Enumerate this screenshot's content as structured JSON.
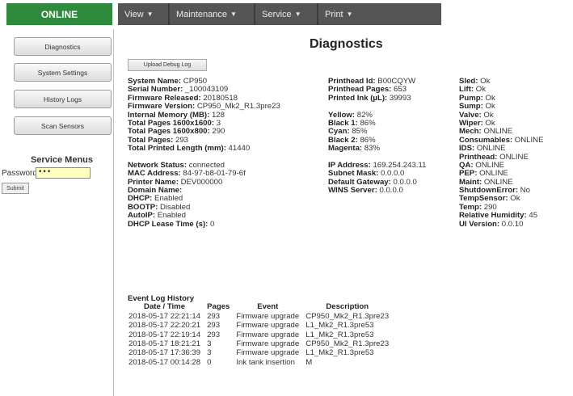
{
  "header": {
    "status": "ONLINE",
    "menu": [
      {
        "label": "View",
        "caret": "▼"
      },
      {
        "label": "Maintenance",
        "caret": "▼"
      },
      {
        "label": "Service",
        "caret": "▼"
      },
      {
        "label": "Print",
        "caret": "▼"
      }
    ]
  },
  "sidebar": {
    "buttons": [
      "Diagnostics",
      "System Settings",
      "History Logs",
      "Scan Sensors"
    ],
    "service_title": "Service Menus",
    "password_label": "Password",
    "password_value": "•••",
    "submit_label": "Submit"
  },
  "main": {
    "title": "Diagnostics",
    "upload_label": "Upload Debug Log",
    "col1_top": [
      {
        "k": "System Name:",
        "v": " CP950"
      },
      {
        "k": "Serial Number:",
        "v": " _100043109"
      },
      {
        "k": "Firmware Released:",
        "v": " 20180518"
      },
      {
        "k": "Firmware Version:",
        "v": " CP950_Mk2_R1.3pre23"
      },
      {
        "k": "Internal Memory (MB):",
        "v": " 128"
      },
      {
        "k": "Total Pages 1600x1600:",
        "v": " 3"
      },
      {
        "k": "Total Pages 1600x800:",
        "v": " 290"
      },
      {
        "k": "Total Pages:",
        "v": " 293"
      },
      {
        "k": "Total Printed Length (mm):",
        "v": " 41440"
      }
    ],
    "col1_bottom": [
      {
        "k": "Network Status:",
        "v": " connected"
      },
      {
        "k": "MAC Address:",
        "v": " 84-97-b8-01-79-6f"
      },
      {
        "k": "Printer Name:",
        "v": " DEV000000"
      },
      {
        "k": "Domain Name:",
        "v": ""
      },
      {
        "k": "DHCP:",
        "v": " Enabled"
      },
      {
        "k": "BOOTP:",
        "v": " Disabled"
      },
      {
        "k": "AutoIP:",
        "v": " Enabled"
      },
      {
        "k": "DHCP Lease Time (s):",
        "v": " 0"
      }
    ],
    "col2_top": [
      {
        "k": "Printhead Id:",
        "v": " B00CQYW"
      },
      {
        "k": "Printhead Pages:",
        "v": " 653"
      },
      {
        "k": "Printed Ink (µL):",
        "v": " 39993"
      }
    ],
    "col2_ink": [
      {
        "k": "Yellow:",
        "v": " 82%"
      },
      {
        "k": "Black 1:",
        "v": " 86%"
      },
      {
        "k": "Cyan:",
        "v": " 85%"
      },
      {
        "k": "Black 2:",
        "v": " 86%"
      },
      {
        "k": "Magenta:",
        "v": " 83%"
      }
    ],
    "col2_net": [
      {
        "k": "IP Address:",
        "v": " 169.254.243.11"
      },
      {
        "k": "Subnet Mask:",
        "v": " 0.0.0.0"
      },
      {
        "k": "Default Gateway:",
        "v": " 0.0.0.0"
      },
      {
        "k": "WINS Server:",
        "v": " 0.0.0.0"
      }
    ],
    "col3": [
      {
        "k": "Sled:",
        "v": " Ok"
      },
      {
        "k": "Lift:",
        "v": " Ok"
      },
      {
        "k": "Pump:",
        "v": " Ok"
      },
      {
        "k": "Sump:",
        "v": " Ok"
      },
      {
        "k": "Valve:",
        "v": " Ok"
      },
      {
        "k": "Wiper:",
        "v": " Ok"
      },
      {
        "k": "Mech:",
        "v": " ONLINE"
      },
      {
        "k": "Consumables:",
        "v": " ONLINE"
      },
      {
        "k": "IDS:",
        "v": " ONLINE"
      },
      {
        "k": "Printhead:",
        "v": " ONLINE"
      },
      {
        "k": "QA:",
        "v": " ONLINE"
      },
      {
        "k": "PEP:",
        "v": " ONLINE"
      },
      {
        "k": "Maint:",
        "v": " ONLINE"
      },
      {
        "k": "ShutdownError:",
        "v": " No"
      },
      {
        "k": "TempSensor:",
        "v": " Ok"
      },
      {
        "k": "Temp:",
        "v": " 290"
      },
      {
        "k": "Relative Humidity:",
        "v": " 45"
      },
      {
        "k": "UI Version:",
        "v": " 0.0.10"
      }
    ]
  },
  "event_log": {
    "title": "Event Log History",
    "headers": [
      "Date / Time",
      "Pages",
      "Event",
      "Description"
    ],
    "rows": [
      [
        "2018-05-17 22:21:14",
        "293",
        "Firmware upgrade",
        "CP950_Mk2_R1.3pre23"
      ],
      [
        "2018-05-17 22:20:21",
        "293",
        "Firmware upgrade",
        "L1_Mk2_R1.3pre53"
      ],
      [
        "2018-05-17 22:19:14",
        "293",
        "Firmware upgrade",
        "L1_Mk2_R1.3pre53"
      ],
      [
        "2018-05-17 18:21:21",
        "3",
        "Firmware upgrade",
        "CP950_Mk2_R1.3pre23"
      ],
      [
        "2018-05-17 17:36:39",
        "3",
        "Firmware upgrade",
        "L1_Mk2_R1.3pre53"
      ],
      [
        "2018-05-17 00:14:28",
        "0",
        "Ink tank insertion",
        "M"
      ]
    ]
  }
}
